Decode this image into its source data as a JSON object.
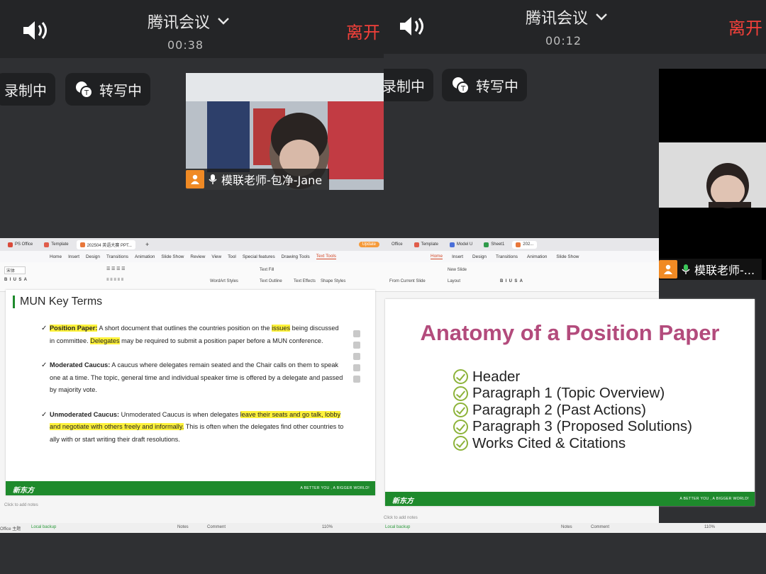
{
  "left": {
    "meeting_title": "腾讯会议",
    "timer": "00:38",
    "leave_label": "离开",
    "record_label": "录制中",
    "transcribe_label": "转写中",
    "participant_name": "模联老师-包净-Jane",
    "app": {
      "tabs": [
        "PS Office",
        "Template",
        "202504 英语大赛 PPT..."
      ],
      "update_label": "Update",
      "menus": [
        "Home",
        "Insert",
        "Design",
        "Transitions",
        "Animation",
        "Slide Show",
        "Review",
        "View",
        "Tool",
        "Special features",
        "Drawing Tools",
        "Text Tools"
      ],
      "ribbon_labels": [
        "宋体",
        "Text Fill",
        "WordArt Styles",
        "Text Outline",
        "Text Effects",
        "Shape Styles"
      ],
      "slide_title": "MUN Key Terms",
      "terms": [
        {
          "term": "Position Paper:",
          "parts": [
            " A short document that outlines the countries position on the ",
            "issues",
            " being discussed in committee. ",
            "Delegates",
            " may be required to submit a position paper before a MUN conference."
          ]
        },
        {
          "term": "Moderated Caucus:",
          "text": " A caucus where delegates remain seated and the Chair calls on them to speak one at a time. The topic, general time and individual speaker time is offered by a delegate and passed by majority vote."
        },
        {
          "term": "Unmoderated Caucus:",
          "parts": [
            " Unmoderated Caucus is when delegates ",
            "leave their seats and go talk, lobby and negotiate with others freely and informally.",
            " This is often when the delegates find other countries to ally with or start writing their draft resolutions."
          ]
        }
      ],
      "footer_logo": "新东方",
      "footer_tagline": "A BETTER YOU , A BIGGER WORLD!",
      "notes_placeholder": "Click to add notes",
      "status": {
        "office": "Office 主题",
        "backup": "Local backup",
        "notes": "Notes",
        "comment": "Comment",
        "zoom": "110%"
      }
    }
  },
  "right": {
    "meeting_title": "腾讯会议",
    "timer": "00:12",
    "leave_label": "离开",
    "record_label": "录制中",
    "transcribe_label": "转写中",
    "participant_name": "模联老师-...",
    "app": {
      "tabs": [
        "Office",
        "Template",
        "Model U",
        "Sheet1",
        "202...",
        "Sample",
        "模联课件",
        "Position"
      ],
      "menus": [
        "Home",
        "Insert",
        "Design",
        "Transitions",
        "Animation",
        "Slide Show",
        "Review",
        "View"
      ],
      "ribbon_labels": [
        "From Current Slide",
        "New Slide",
        "Layout"
      ],
      "slide_title": "Anatomy of a Position Paper",
      "items": [
        "Header",
        "Paragraph 1 (Topic Overview)",
        "Paragraph 2 (Past Actions)",
        "Paragraph 3 (Proposed Solutions)",
        "Works Cited & Citations"
      ],
      "footer_logo": "新东方",
      "footer_tagline": "A BETTER YOU , A BIGGER WORLD!",
      "notes_placeholder": "Click to add notes",
      "status": {
        "backup": "Local backup",
        "notes": "Notes",
        "comment": "Comment",
        "zoom": "110%"
      }
    }
  },
  "colors": {
    "leave": "#f2403a",
    "accent_green": "#1e8a2c",
    "title_pink": "#b34b7c",
    "highlight": "#fff23a",
    "avatar_orange": "#f08a24"
  }
}
